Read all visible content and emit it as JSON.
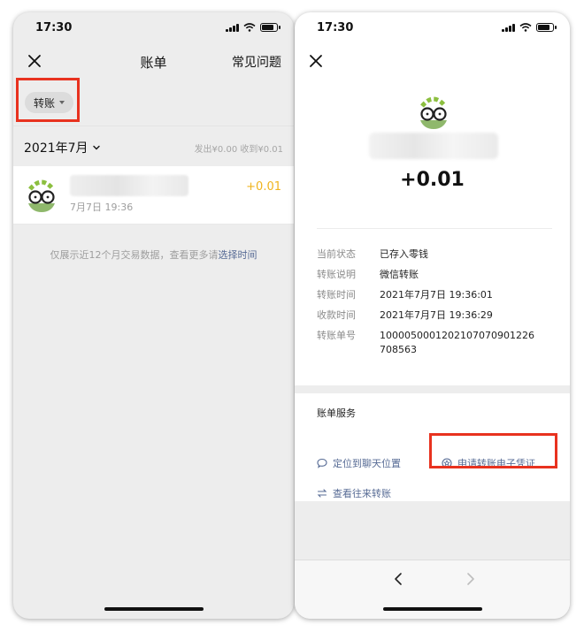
{
  "colors": {
    "accent_link": "#576b95",
    "amount_yellow": "#f0b41e",
    "highlight_red": "#e8321f"
  },
  "left_screen": {
    "status_time": "17:30",
    "nav": {
      "title": "账单",
      "right_label": "常见问题",
      "close_icon": "close-icon"
    },
    "filter_label": "转账",
    "month_label": "2021年7月",
    "summary": "发出¥0.00  收到¥0.01",
    "transactions": [
      {
        "date": "7月7日 19:36",
        "amount": "+0.01"
      }
    ],
    "note_text": "仅展示近12个月交易数据，查看更多请",
    "note_link": "选择时间"
  },
  "right_screen": {
    "status_time": "17:30",
    "amount": "+0.01",
    "details": [
      {
        "key": "当前状态",
        "value": "已存入零钱"
      },
      {
        "key": "转账说明",
        "value": "微信转账"
      },
      {
        "key": "转账时间",
        "value": "2021年7月7日 19:36:01"
      },
      {
        "key": "收款时间",
        "value": "2021年7月7日 19:36:29"
      },
      {
        "key": "转账单号",
        "value": "1000050001202107070901226708563"
      }
    ],
    "services_title": "账单服务",
    "services": [
      {
        "label": "定位到聊天位置",
        "icon": "chat-bubble-icon"
      },
      {
        "label": "申请转账电子凭证",
        "icon": "star-badge-icon"
      },
      {
        "label": "查看往来转账",
        "icon": "swap-arrows-icon"
      }
    ]
  }
}
